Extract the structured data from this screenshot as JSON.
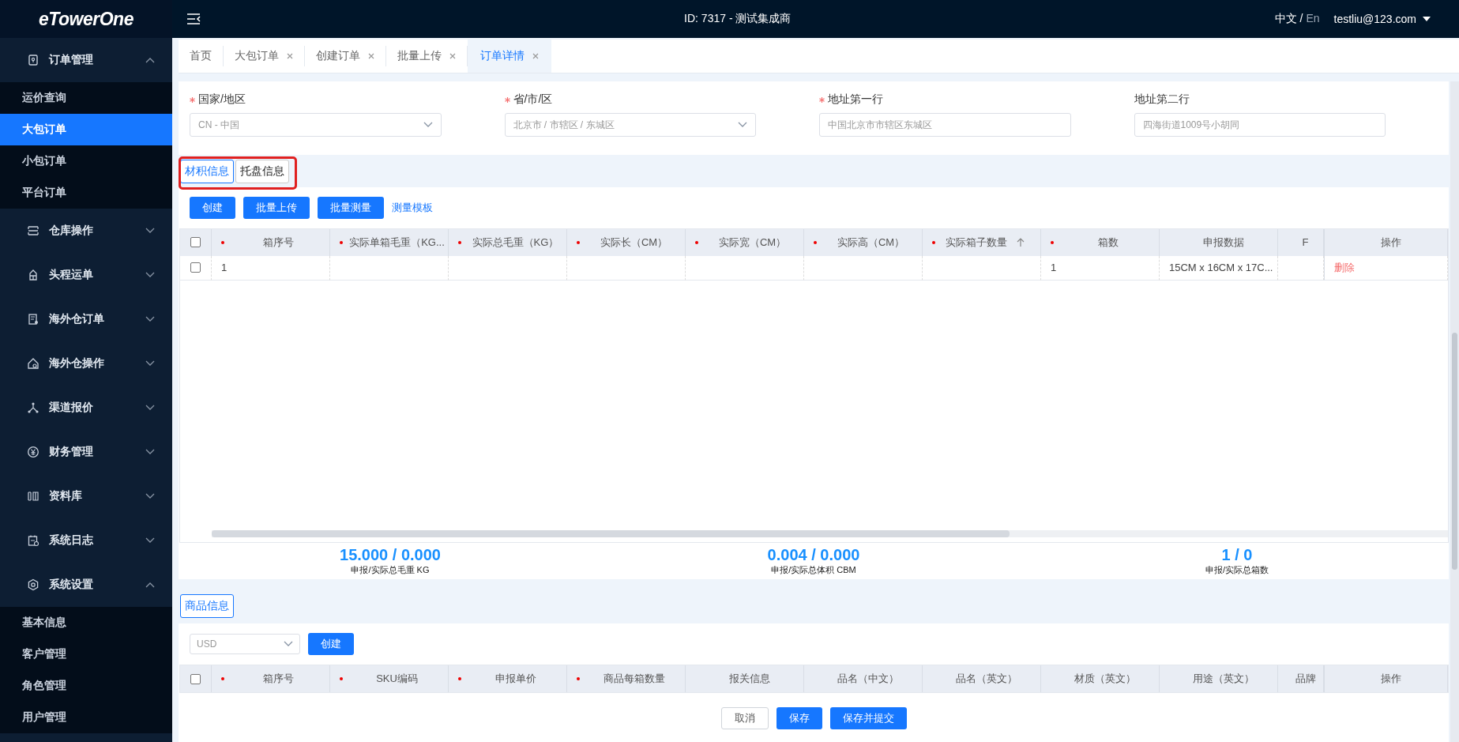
{
  "brand": {
    "logo": "eTowerOne"
  },
  "sidebar": {
    "groups": [
      {
        "label": "订单管理",
        "expanded": true,
        "children": [
          {
            "label": "运价查询",
            "selected": false
          },
          {
            "label": "大包订单",
            "selected": true
          },
          {
            "label": "小包订单",
            "selected": false
          },
          {
            "label": "平台订单",
            "selected": false
          }
        ]
      },
      {
        "label": "仓库操作",
        "expanded": false
      },
      {
        "label": "头程运单",
        "expanded": false
      },
      {
        "label": "海外仓订单",
        "expanded": false
      },
      {
        "label": "海外仓操作",
        "expanded": false
      },
      {
        "label": "渠道报价",
        "expanded": false
      },
      {
        "label": "财务管理",
        "expanded": false
      },
      {
        "label": "资料库",
        "expanded": false
      },
      {
        "label": "系统日志",
        "expanded": false
      },
      {
        "label": "系统设置",
        "expanded": true,
        "children": [
          {
            "label": "基本信息",
            "selected": false
          },
          {
            "label": "客户管理",
            "selected": false
          },
          {
            "label": "角色管理",
            "selected": false
          },
          {
            "label": "用户管理",
            "selected": false
          }
        ]
      }
    ]
  },
  "header": {
    "title": "ID: 7317 - 测试集成商",
    "languages": [
      {
        "label": "中文",
        "selected": true
      },
      {
        "label": "En",
        "selected": false
      }
    ],
    "language_separator": "/",
    "user": "testliu@123.com"
  },
  "page_tabs": [
    {
      "label": "首页",
      "closable": false,
      "selected": false
    },
    {
      "label": "大包订单",
      "closable": true,
      "selected": false
    },
    {
      "label": "创建订单",
      "closable": true,
      "selected": false
    },
    {
      "label": "批量上传",
      "closable": true,
      "selected": false
    },
    {
      "label": "订单详情",
      "closable": true,
      "selected": true
    }
  ],
  "address_form": [
    {
      "label": "国家/地区",
      "required": true,
      "kind": "select",
      "value": "CN - 中国"
    },
    {
      "label": "省/市/区",
      "required": true,
      "kind": "select",
      "value": "北京市 / 市辖区 / 东城区"
    },
    {
      "label": "地址第一行",
      "required": true,
      "kind": "input",
      "value": "中国北京市市辖区东城区"
    },
    {
      "label": "地址第二行",
      "required": false,
      "kind": "input",
      "value": "四海街道1009号小胡同"
    }
  ],
  "section_tabs": [
    {
      "label": "材积信息",
      "selected": true
    },
    {
      "label": "托盘信息",
      "selected": false
    }
  ],
  "carton_toolbar": {
    "buttons": [
      "创建",
      "批量上传",
      "批量测量"
    ],
    "link": "测量模板"
  },
  "carton_table": {
    "all_checked": false,
    "columns": [
      {
        "label": "箱序号",
        "required": true
      },
      {
        "label": "实际单箱毛重（KG...",
        "required": true
      },
      {
        "label": "实际总毛重（KG）",
        "required": true
      },
      {
        "label": "实际长（CM）",
        "required": true
      },
      {
        "label": "实际宽（CM）",
        "required": true
      },
      {
        "label": "实际高（CM）",
        "required": true
      },
      {
        "label": "实际箱子数量",
        "required": true,
        "sorted": true
      },
      {
        "label": "箱数",
        "required": true
      },
      {
        "label": "申报数据",
        "required": false
      },
      {
        "label": "F",
        "required": false
      },
      {
        "label": "操作",
        "required": false
      }
    ],
    "rows": [
      {
        "checked": false,
        "cells": [
          "1",
          "",
          "",
          "",
          "",
          "",
          "",
          "1",
          "15CM x 16CM x 17C...",
          ""
        ],
        "action": "删除"
      }
    ]
  },
  "totals": [
    {
      "value": "15.000 / 0.000",
      "label": "申报/实际总毛重 KG"
    },
    {
      "value": "0.004 / 0.000",
      "label": "申报/实际总体积 CBM"
    },
    {
      "value": "1 / 0",
      "label": "申报/实际总箱数"
    }
  ],
  "goods_tabs": [
    {
      "label": "商品信息",
      "selected": true
    }
  ],
  "goods_toolbar": {
    "currency": "USD",
    "button": "创建"
  },
  "goods_table": {
    "all_checked": false,
    "columns": [
      {
        "label": "箱序号",
        "required": true
      },
      {
        "label": "SKU编码",
        "required": true
      },
      {
        "label": "申报单价",
        "required": true
      },
      {
        "label": "商品每箱数量",
        "required": true
      },
      {
        "label": "报关信息",
        "required": false
      },
      {
        "label": "品名（中文）",
        "required": false
      },
      {
        "label": "品名（英文）",
        "required": false
      },
      {
        "label": "材质（英文）",
        "required": false
      },
      {
        "label": "用途（英文）",
        "required": false
      },
      {
        "label": "品牌",
        "required": false
      },
      {
        "label": "操作",
        "required": false
      }
    ]
  },
  "footer_buttons": [
    {
      "label": "取消",
      "kind": "default"
    },
    {
      "label": "保存",
      "kind": "primary"
    },
    {
      "label": "保存并提交",
      "kind": "primary"
    }
  ]
}
